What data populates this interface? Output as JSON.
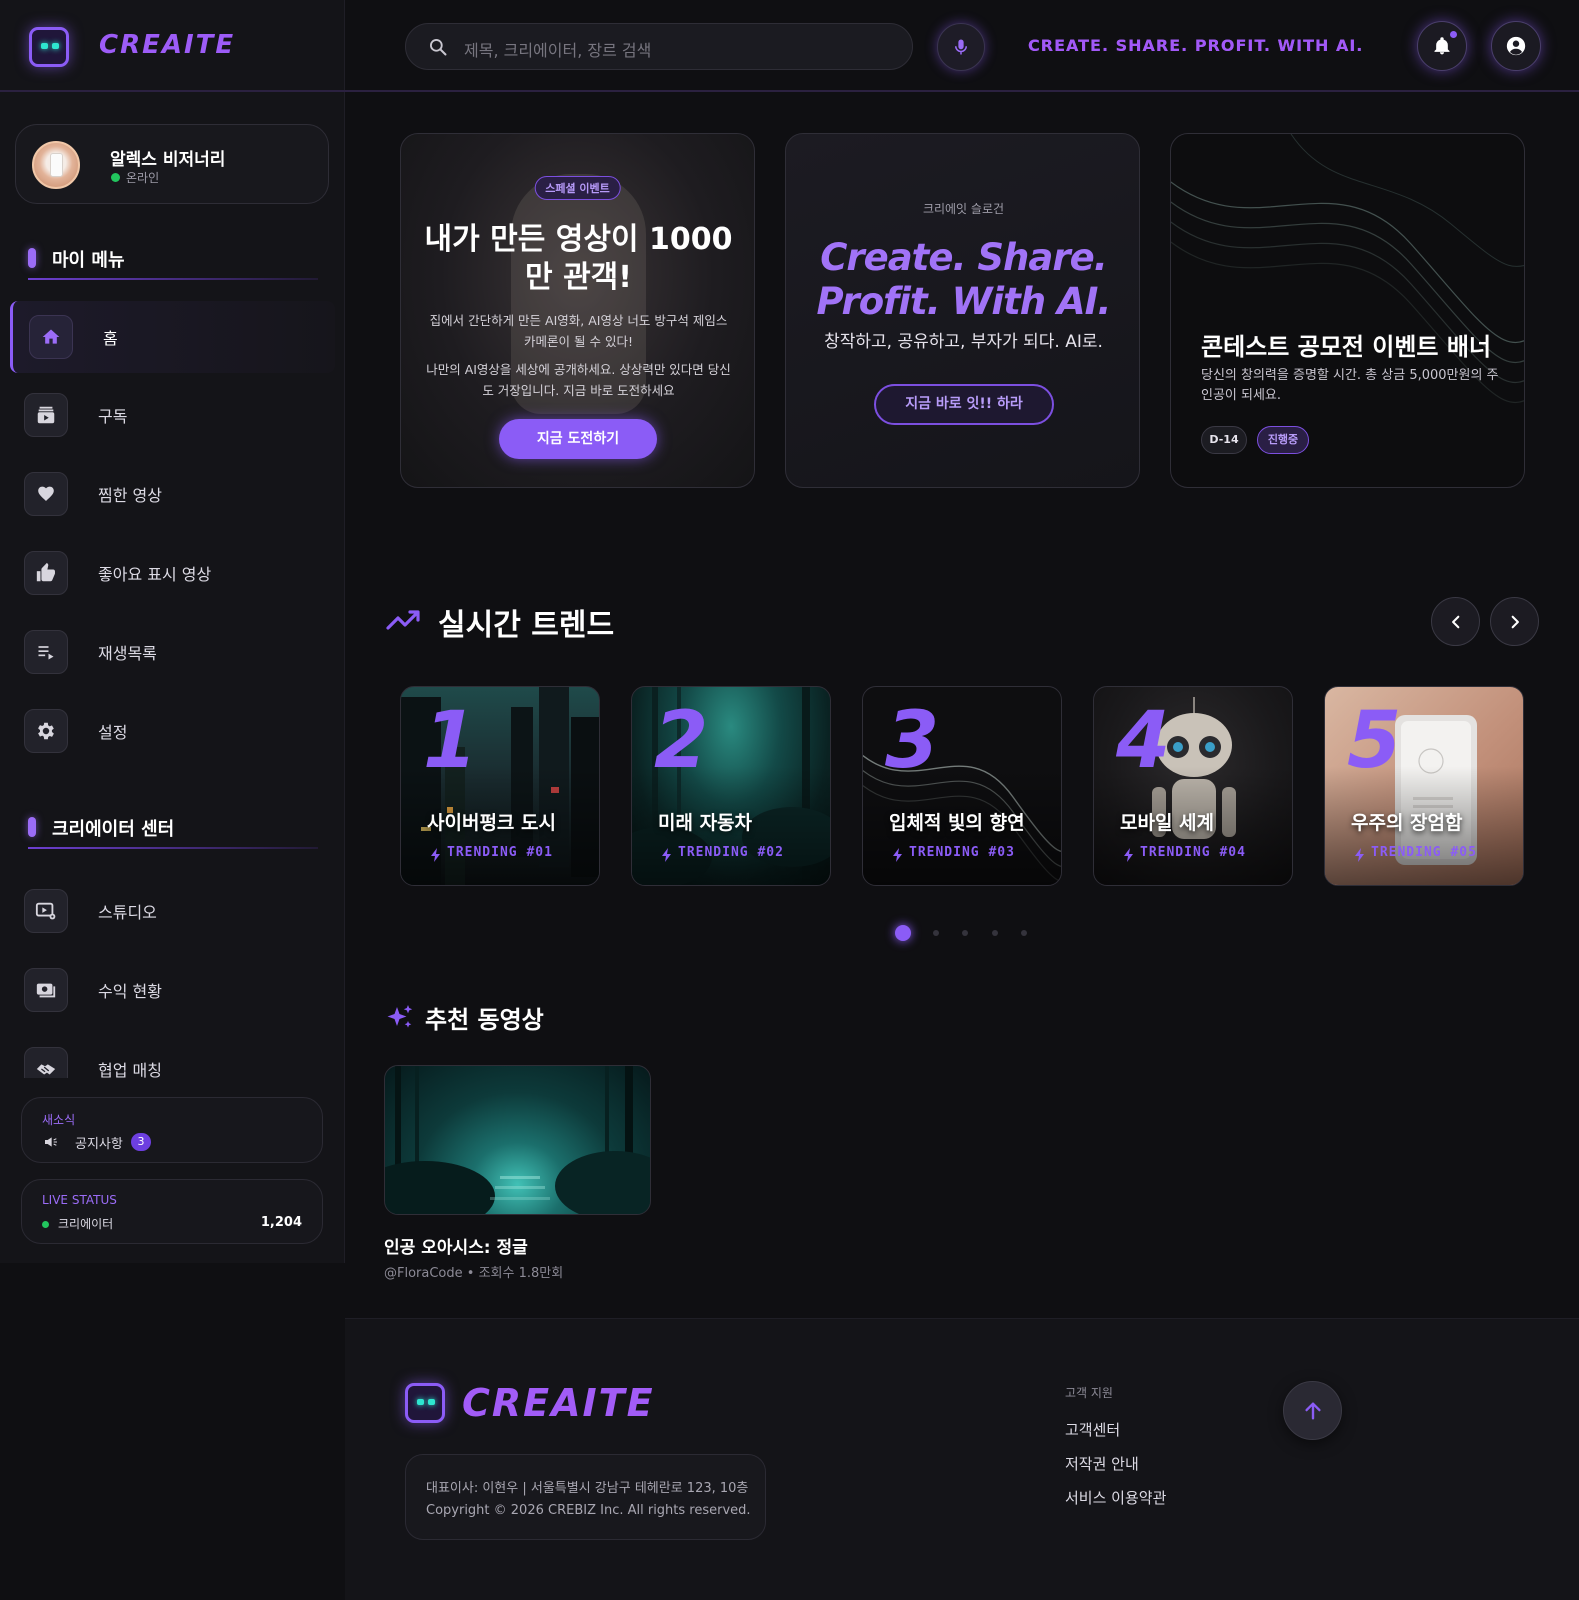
{
  "brand": {
    "name": "CREAITE",
    "slogan": "CREATE. SHARE. PROFIT. WITH AI.",
    "accent": "#8b5cf6"
  },
  "topbar": {
    "search_placeholder": "제목, 크리에이터, 장르 검색"
  },
  "profile": {
    "name": "알렉스 비저너리",
    "status": "온라인"
  },
  "sidebar": {
    "my_menu_title": "마이 메뉴",
    "my_menu": [
      {
        "label": "홈",
        "icon": "home-icon"
      },
      {
        "label": "구독",
        "icon": "subscriptions-icon"
      },
      {
        "label": "찜한 영상",
        "icon": "heart-icon"
      },
      {
        "label": "좋아요 표시 영상",
        "icon": "thumbs-up-icon"
      },
      {
        "label": "재생목록",
        "icon": "playlist-icon"
      },
      {
        "label": "설정",
        "icon": "gear-icon"
      }
    ],
    "creator_title": "크리에이터 센터",
    "creator_menu": [
      {
        "label": "스튜디오",
        "icon": "studio-icon"
      },
      {
        "label": "수익 현황",
        "icon": "money-icon"
      },
      {
        "label": "협업 매칭",
        "icon": "handshake-icon"
      }
    ],
    "news": {
      "kicker": "새소식",
      "label": "공지사항",
      "count": "3"
    },
    "live": {
      "kicker": "LIVE STATUS",
      "label": "크리에이터",
      "value": "1,204"
    }
  },
  "banners": {
    "event": {
      "tag": "스페셜 이벤트",
      "title": "내가 만든 영상이 1000만 관객!",
      "desc1": "집에서 간단하게 만든 AI영화, AI영상 너도 방구석 제임스카메론이 될 수 있다!",
      "desc2": "나만의 AI영상을 세상에 공개하세요. 상상력만 있다면 당신도 거장입니다. 지금 바로 도전하세요",
      "cta": "지금 도전하기"
    },
    "slogan": {
      "kicker": "크리에잇 슬로건",
      "line1": "Create. Share.",
      "line2": "Profit. With AI.",
      "sub": "창작하고, 공유하고, 부자가 되다. AI로.",
      "cta": "지금 바로 잇!! 하라"
    },
    "contest": {
      "title": "콘테스트 공모전 이벤트 배너",
      "desc": "당신의 창의력을 증명할 시간. 총 상금 5,000만원의 주인공이 되세요.",
      "chip1": "D-14",
      "chip2": "진행중"
    }
  },
  "trends": {
    "title": "실시간 트렌드",
    "items": [
      {
        "num": "1",
        "name": "사이버펑크 도시",
        "rank": "TRENDING #01"
      },
      {
        "num": "2",
        "name": "미래 자동차",
        "rank": "TRENDING #02"
      },
      {
        "num": "3",
        "name": "입체적 빛의 향연",
        "rank": "TRENDING #03"
      },
      {
        "num": "4",
        "name": "모바일 세계",
        "rank": "TRENDING #04"
      },
      {
        "num": "5",
        "name": "우주의 장엄함",
        "rank": "TRENDING #05"
      }
    ],
    "active_page": 1,
    "page_count": 5
  },
  "recommended": {
    "title": "추천 동영상",
    "video": {
      "title": "인공 오아시스: 정글",
      "meta": "@FloraCode • 조회수 1.8만회"
    }
  },
  "footer": {
    "brand": "CREAITE",
    "info1": "대표이사: 이현우 | 서울특별시 강남구 테헤란로 123, 10층",
    "info2": "Copyright © 2026 CREBIZ Inc. All rights reserved.",
    "support_title": "고객 지원",
    "links": [
      "고객센터",
      "저작권 안내",
      "서비스 이용약관"
    ]
  }
}
